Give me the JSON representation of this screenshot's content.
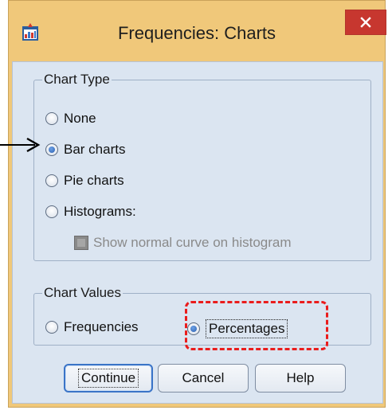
{
  "window": {
    "title": "Frequencies: Charts",
    "icons": {
      "app": "spss-chart-icon",
      "close": "close-icon"
    },
    "colors": {
      "titlebar": "#f0c87a",
      "close": "#c7372f",
      "client": "#dbe5f1"
    }
  },
  "chart_type": {
    "label": "Chart Type",
    "options": [
      {
        "label": "None",
        "selected": false
      },
      {
        "label": "Bar charts",
        "selected": true
      },
      {
        "label": "Pie charts",
        "selected": false
      },
      {
        "label": "Histograms:",
        "selected": false
      }
    ],
    "normal_curve": {
      "label": "Show normal curve on histogram",
      "checked": false,
      "enabled": false
    }
  },
  "chart_values": {
    "label": "Chart Values",
    "options": [
      {
        "label": "Frequencies",
        "selected": false
      },
      {
        "label": "Percentages",
        "selected": true
      }
    ]
  },
  "buttons": {
    "continue": "Continue",
    "cancel": "Cancel",
    "help": "Help"
  },
  "annotations": {
    "arrow_color": "#000000",
    "highlight_color": "#ea1c1c"
  }
}
